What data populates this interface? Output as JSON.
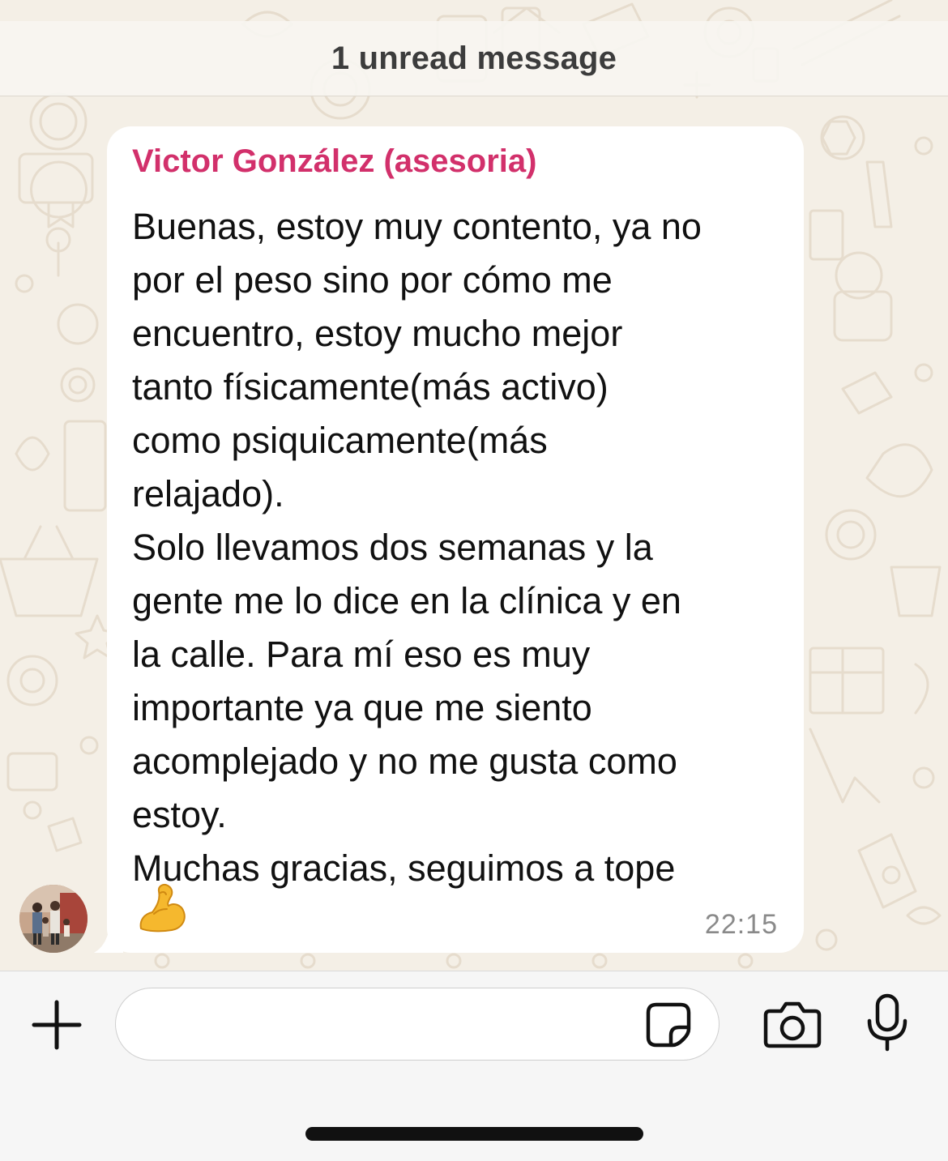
{
  "banner": {
    "unread_text": "1 unread message"
  },
  "message": {
    "sender": "Victor González (asesoria)",
    "lines": [
      "Buenas, estoy muy contento, ya no",
      "por el peso sino por cómo me",
      "encuentro, estoy mucho mejor",
      "tanto físicamente(más activo)",
      "como psiquicamente(más",
      "relajado).",
      "Solo llevamos dos semanas y la",
      "gente me lo dice en la clínica y en",
      "la calle. Para mí eso es muy",
      "importante ya que me siento",
      "acomplejado y no me gusta como",
      "estoy.",
      "Muchas gracias, seguimos a tope"
    ],
    "emoji": "flexed-biceps-emoji",
    "time": "22:15"
  },
  "composer": {
    "placeholder": "",
    "icons": [
      "plus-icon",
      "sticker-icon",
      "camera-icon",
      "microphone-icon"
    ]
  },
  "colors": {
    "sender_name": "#d2306b",
    "chat_background": "#f4efe6",
    "bubble": "#ffffff",
    "input_bar": "#f6f6f6"
  }
}
